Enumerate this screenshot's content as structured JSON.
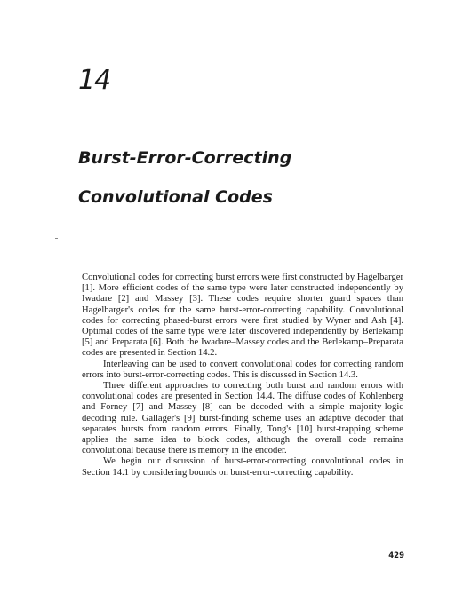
{
  "chapter": {
    "number": "14",
    "title_line1": "Burst-Error-Correcting",
    "title_line2": "Convolutional Codes"
  },
  "paragraphs": [
    "Convolutional codes for correcting burst errors were first constructed by Hagelbarger [1]. More efficient codes of the same type were later constructed independently by Iwadare [2] and Massey [3]. These codes require shorter guard spaces than Hagelbarger's codes for the same burst-error-correcting capability. Convolutional codes for correcting phased-burst errors were first studied by Wyner and Ash [4]. Optimal codes of the same type were later discovered independently by Berlekamp [5] and Preparata [6]. Both the Iwadare–Massey codes and the Berlekamp–Preparata codes are presented in Section 14.2.",
    "Interleaving can be used to convert convolutional codes for correcting random errors into burst-error-correcting codes. This is discussed in Section 14.3.",
    "Three different approaches to correcting both burst and random errors with convolutional codes are presented in Section 14.4. The diffuse codes of Kohlenberg and Forney [7] and Massey [8] can be decoded with a simple majority-logic decoding rule. Gallager's [9] burst-finding scheme uses an adaptive decoder that separates bursts from random errors. Finally, Tong's [10] burst-trapping scheme applies the same idea to block codes, although the overall code remains convolutional because there is memory in the encoder.",
    "We begin our discussion of burst-error-correcting convolutional codes in Section 14.1 by considering bounds on burst-error-correcting capability."
  ],
  "page_number": "429"
}
